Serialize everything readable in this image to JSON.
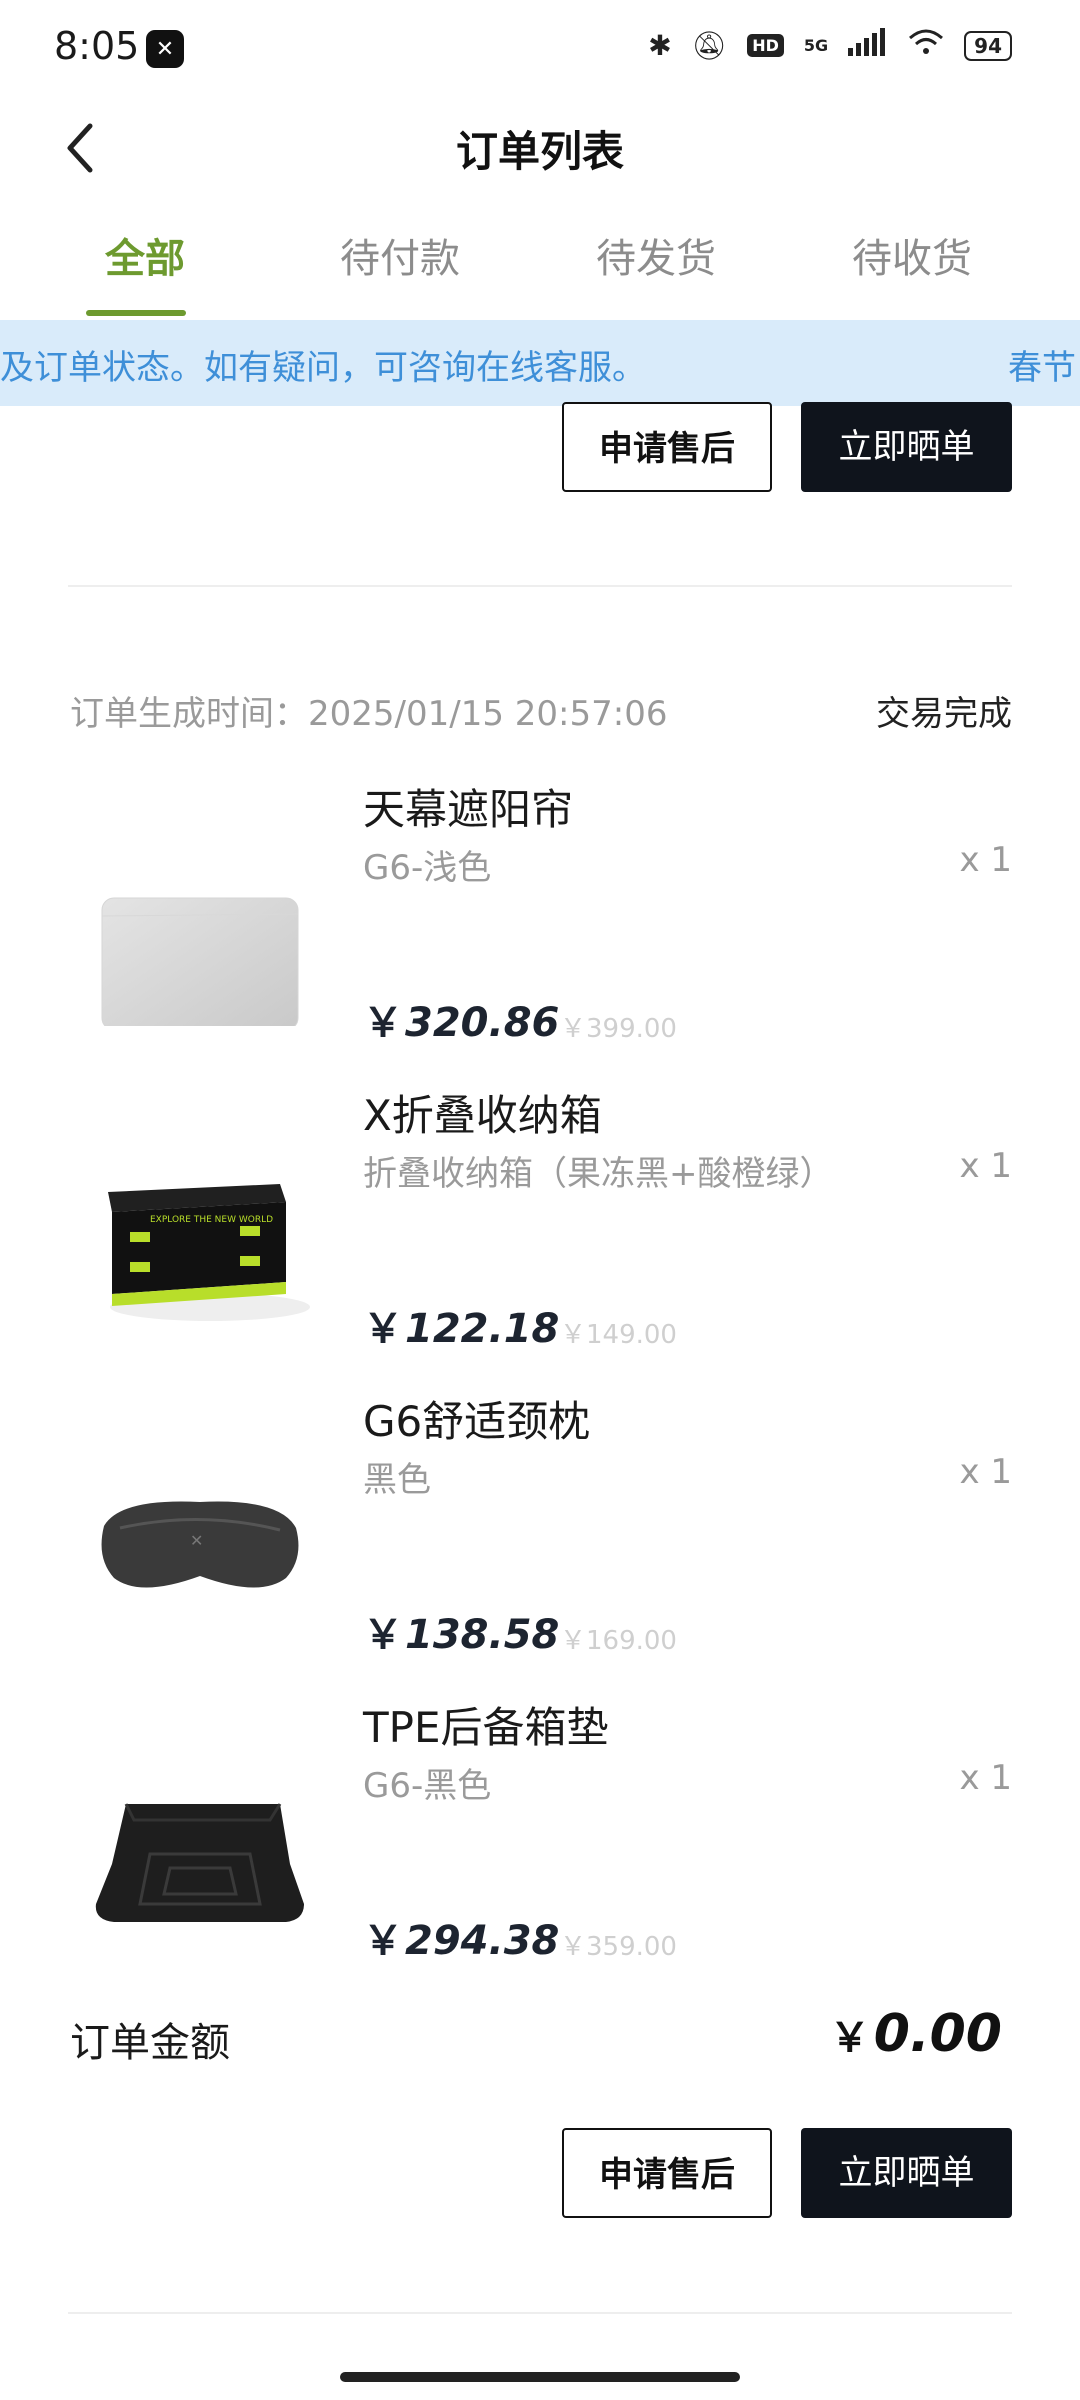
{
  "status_bar": {
    "time": "8:05",
    "app_badge": "✕",
    "hd": "HD",
    "network": "5G",
    "battery": "94"
  },
  "header": {
    "title": "订单列表",
    "back_icon": "chevron-left-icon"
  },
  "tabs": [
    {
      "label": "全部",
      "active": true
    },
    {
      "label": "待付款",
      "active": false
    },
    {
      "label": "待发货",
      "active": false
    },
    {
      "label": "待收货",
      "active": false
    }
  ],
  "notice": {
    "text": "及订单状态。如有疑问，可咨询在线客服。",
    "text_next": "春节"
  },
  "prev_order": {
    "after_sale_label": "申请售后",
    "review_label": "立即晒单"
  },
  "order": {
    "time_label": "订单生成时间：2025/01/15 20:57:06",
    "status": "交易完成",
    "items": [
      {
        "name": "天幕遮阳帘",
        "spec": "G6-浅色",
        "qty": "x 1",
        "yen": "￥",
        "price": "320.86",
        "orig_price": "￥399.00",
        "image": "sunshade-image"
      },
      {
        "name": "X折叠收纳箱",
        "spec": "折叠收纳箱（果冻黑+酸橙绿）",
        "qty": "x 1",
        "yen": "￥",
        "price": "122.18",
        "orig_price": "￥149.00",
        "image": "storage-box-image"
      },
      {
        "name": "G6舒适颈枕",
        "spec": "黑色",
        "qty": "x 1",
        "yen": "￥",
        "price": "138.58",
        "orig_price": "￥169.00",
        "image": "neck-pillow-image"
      },
      {
        "name": "TPE后备箱垫",
        "spec": "G6-黑色",
        "qty": "x 1",
        "yen": "￥",
        "price": "294.38",
        "orig_price": "￥359.00",
        "image": "trunk-mat-image"
      }
    ],
    "total_label": "订单金额",
    "total_yen": "￥",
    "total_value": "0.00",
    "after_sale_label": "申请售后",
    "review_label": "立即晒单"
  },
  "colors": {
    "accent": "#6d9a2f",
    "notice_bg": "#d9ebfa",
    "notice_text": "#3e8fd8",
    "dark_button": "#0f141c"
  }
}
